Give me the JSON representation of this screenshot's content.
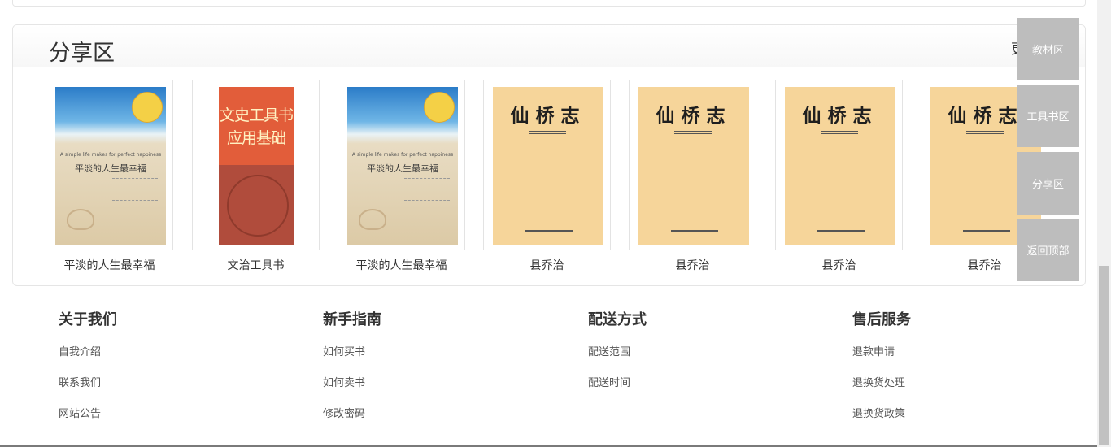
{
  "share": {
    "title": "分享区",
    "more": "更"
  },
  "books": [
    {
      "title": "平淡的人生最幸福",
      "cover": "beach",
      "cover_text": "平淡的人生最幸福",
      "cover_sub": "A simple life makes for perfect happiness"
    },
    {
      "title": "文治工具书",
      "cover": "red",
      "cover_line1": "文史工具书",
      "cover_line2": "应用基础"
    },
    {
      "title": "平淡的人生最幸福",
      "cover": "beach",
      "cover_text": "平淡的人生最幸福",
      "cover_sub": "A simple life makes for perfect happiness"
    },
    {
      "title": "县乔治",
      "cover": "tan",
      "cover_text": "仙桥志"
    },
    {
      "title": "县乔治",
      "cover": "tan",
      "cover_text": "仙桥志"
    },
    {
      "title": "县乔治",
      "cover": "tan",
      "cover_text": "仙桥志"
    },
    {
      "title": "县乔治",
      "cover": "tan",
      "cover_text": "仙桥志"
    }
  ],
  "side_nav": {
    "items": [
      "教材区",
      "工具书区",
      "分享区",
      "返回顶部"
    ]
  },
  "footer": {
    "columns": [
      {
        "title": "关于我们",
        "links": [
          "自我介绍",
          "联系我们",
          "网站公告"
        ]
      },
      {
        "title": "新手指南",
        "links": [
          "如何买书",
          "如何卖书",
          "修改密码"
        ]
      },
      {
        "title": "配送方式",
        "links": [
          "配送范围",
          "配送时间"
        ]
      },
      {
        "title": "售后服务",
        "links": [
          "退款申请",
          "退换货处理",
          "退换货政策"
        ]
      }
    ]
  },
  "colors": {
    "side_button": "#bdbdbd",
    "border": "#e5e5e5",
    "text": "#333333"
  }
}
